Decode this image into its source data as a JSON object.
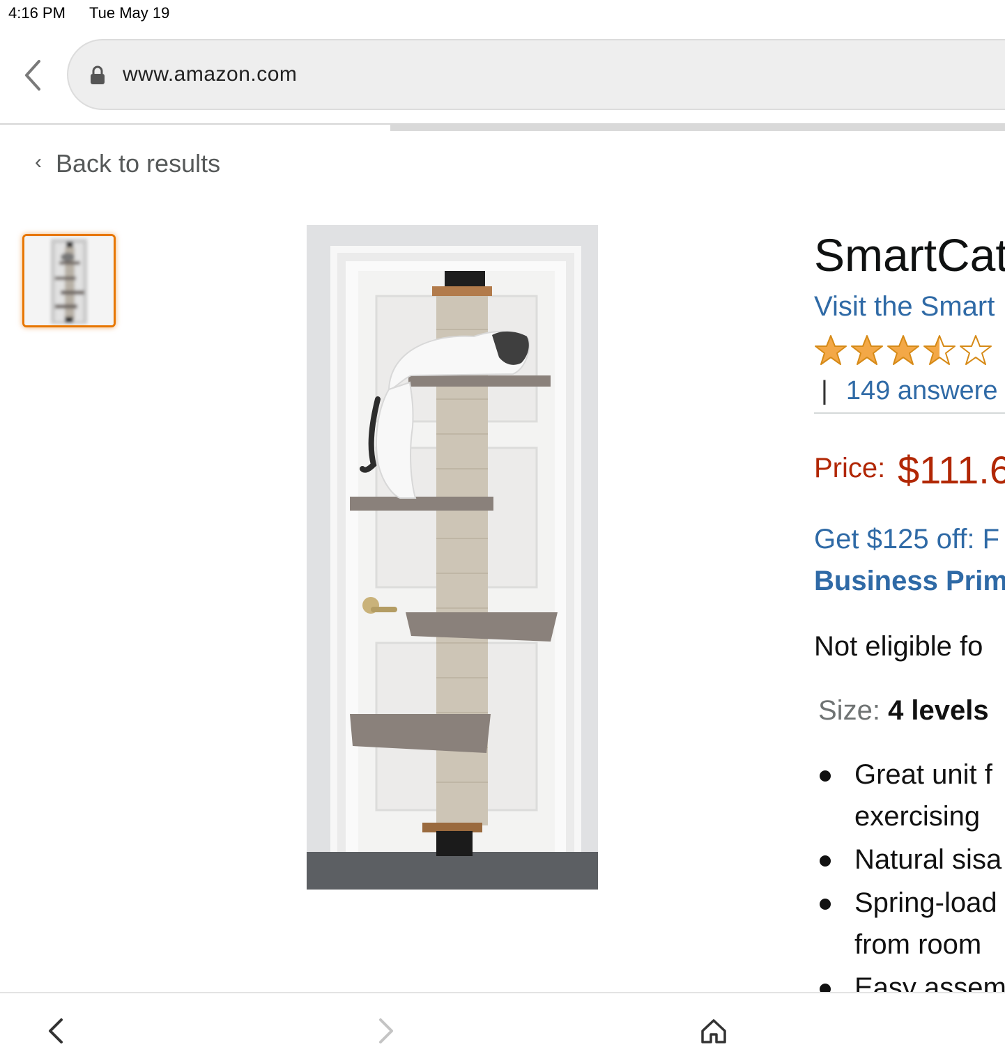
{
  "status_bar": {
    "time": "4:16 PM",
    "date": "Tue May 19"
  },
  "browser": {
    "url": "www.amazon.com",
    "back_icon": "chevron-left-icon",
    "lock_icon": "lock-icon",
    "load_progress": 0.39
  },
  "breadcrumb": {
    "chevron": "‹",
    "label": "Back to results"
  },
  "gallery": {
    "selected_thumbnail_index": 0,
    "thumbnail_border_color": "#e77600"
  },
  "product": {
    "title": "SmartCat",
    "store_link": "Visit the Smart",
    "rating": {
      "stars": 3.5,
      "max": 5,
      "star_color": "#f3a847"
    },
    "answers": {
      "separator": "|",
      "label": "149 answere"
    },
    "price": {
      "label": "Price:",
      "value": "$111.6",
      "color": "#b12704"
    },
    "promo": {
      "text": "Get $125 off: F",
      "brand": "Business Prim"
    },
    "eligibility": "Not eligible fo",
    "size": {
      "label": "Size:",
      "value": "4 levels"
    },
    "bullets": [
      {
        "line1": "Great unit f",
        "line2": "exercising"
      },
      {
        "line1": "Natural sisa",
        "line2": ""
      },
      {
        "line1": "Spring-load",
        "line2": "from room "
      },
      {
        "line1": "Easy assem",
        "line2": ""
      }
    ]
  },
  "bottom_nav": {
    "back_icon": "chevron-left-icon",
    "forward_icon": "chevron-right-icon",
    "home_icon": "home-icon"
  },
  "colors": {
    "link": "#2f6aa6",
    "price": "#b12704",
    "muted": "#565959"
  }
}
